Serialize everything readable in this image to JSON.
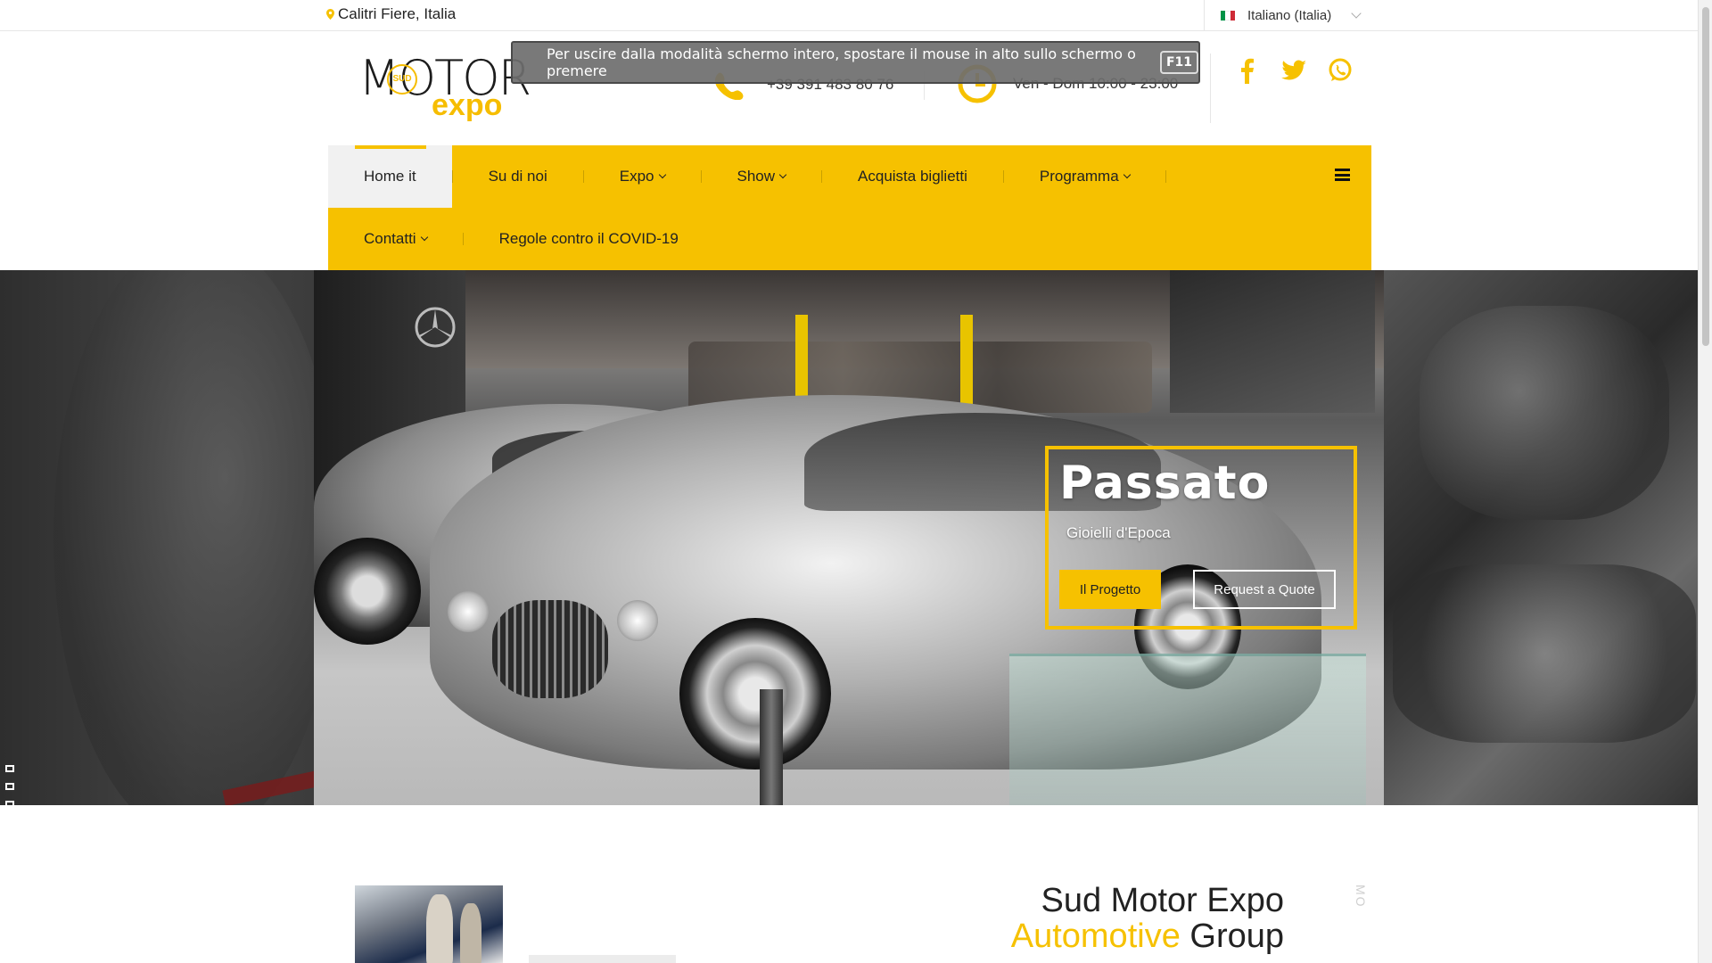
{
  "topbar": {
    "location": "Calitri Fiere, Italia",
    "language": "Italiano (Italia)",
    "flag_colors": [
      "#009246",
      "#ffffff",
      "#ce2b37"
    ]
  },
  "logo": {
    "motor": "MOTOR",
    "sud": "SUD",
    "expo": "expo"
  },
  "fullscreen_notice": {
    "text": "Per uscire dalla modalità schermo intero, spostare il mouse in alto sullo schermo o premere",
    "key": "F11"
  },
  "contact": {
    "phone": "+39 391 483 80 76",
    "hours": "Ven - Dom 10:00 - 23:00"
  },
  "social": [
    "facebook-icon",
    "twitter-icon",
    "whatsapp-icon"
  ],
  "nav": {
    "row1": [
      "Home it",
      "Su di noi",
      "Expo",
      "Show",
      "Acquista biglietti",
      "Programma"
    ],
    "row2": [
      "Contatti",
      "Regole contro il COVID-19"
    ]
  },
  "hero": {
    "title": "Passato",
    "subtitle": "Gioielli d'Epoca",
    "primary_button": "Il Progetto",
    "secondary_button": "Request a Quote",
    "slides_total": 4,
    "active_slide": 4
  },
  "section": {
    "title_line1": "Sud Motor Expo",
    "title_accent": "Automotive",
    "title_rest": " Group",
    "vertical_label": "SU SUD MO"
  },
  "colors": {
    "accent": "#f6c100",
    "text": "#222222"
  }
}
